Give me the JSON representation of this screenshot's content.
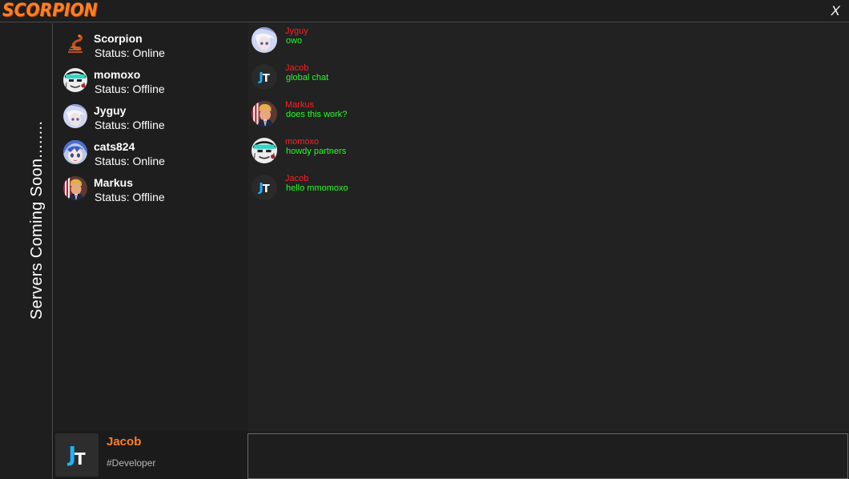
{
  "app": {
    "title": "SCORPION",
    "close_label": "X"
  },
  "servers": {
    "label": "Servers  Coming Soon........"
  },
  "friends": [
    {
      "name": "Scorpion",
      "status": "Status: Online"
    },
    {
      "name": "momoxo",
      "status": "Status: Offline"
    },
    {
      "name": "Jyguy",
      "status": "Status: Offline"
    },
    {
      "name": "cats824",
      "status": "Status: Online"
    },
    {
      "name": "Markus",
      "status": "Status: Offline"
    }
  ],
  "messages": [
    {
      "author": "Jyguy",
      "text": "owo"
    },
    {
      "author": "Jacob",
      "text": "global chat"
    },
    {
      "author": "Markus",
      "text": "does this work?"
    },
    {
      "author": "momoxo",
      "text": "howdy partners"
    },
    {
      "author": "Jacob",
      "text": "hello mmomoxo"
    }
  ],
  "current_user": {
    "name": "Jacob",
    "tag": "#Developer",
    "avatar_letters": {
      "j": "J",
      "t": "T"
    }
  },
  "message_input": {
    "value": "",
    "placeholder": ""
  },
  "colors": {
    "brand": "#ff7f27",
    "author": "#ff2020",
    "message": "#22ff22",
    "avatar_accent": "#19b6ff",
    "background": "#1e1e1e"
  }
}
